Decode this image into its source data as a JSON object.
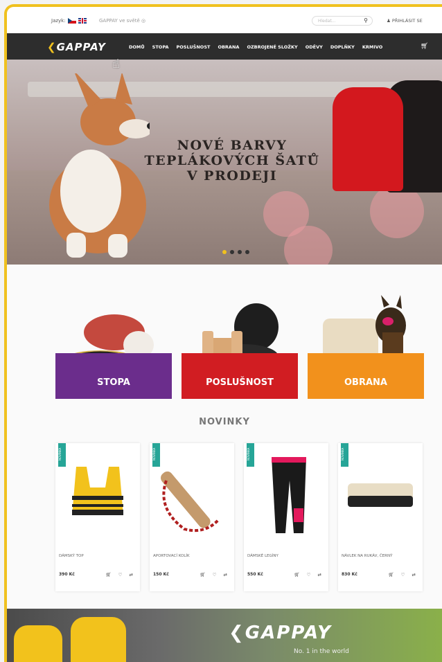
{
  "topbar": {
    "lang_label": "Jazyk:",
    "world_link": "GAPPAY ve světě",
    "search_placeholder": "Hledat...",
    "login": "PŘIHLÁSIT SE"
  },
  "nav": {
    "logo": "GAPPAY",
    "items": [
      "DOMŮ",
      "STOPA",
      "POSLUŠNOST",
      "OBRANA",
      "OZBROJENÉ SLOŽKY",
      "ODĚVY",
      "DOPLŇKY",
      "KRMIVO"
    ]
  },
  "hero": {
    "line1": "NOVÉ BARVY",
    "line2": "TEPLÁKOVÝCH ŠATŮ",
    "line3": "V PRODEJI",
    "slides": 4,
    "active_slide": 1
  },
  "categories": [
    {
      "label": "STOPA",
      "color": "#6b2d8c"
    },
    {
      "label": "POSLUŠNOST",
      "color": "#d11d22"
    },
    {
      "label": "OBRANA",
      "color": "#f2911c"
    }
  ],
  "novinky_title": "NOVINKY",
  "products": [
    {
      "tag": "NOVINKA",
      "name": "DÁMSKÝ TOP",
      "price": "390 Kč"
    },
    {
      "tag": "NOVINKA",
      "name": "APORTOVACÍ KOLÍK",
      "price": "150 Kč"
    },
    {
      "tag": "NOVINKA",
      "name": "DÁMSKÉ LEGÍNY",
      "price": "550 Kč"
    },
    {
      "tag": "NOVINKA",
      "name": "NÁVLEK NA RUKÁV, ČERNÝ",
      "price": "830 Kč"
    }
  ],
  "footer_banner": {
    "logo": "GAPPAY",
    "slogan": "No. 1 in the world"
  },
  "colors": {
    "accent": "#f0c11f",
    "nav_bg": "#2d2d2d",
    "tag": "#26a597"
  }
}
